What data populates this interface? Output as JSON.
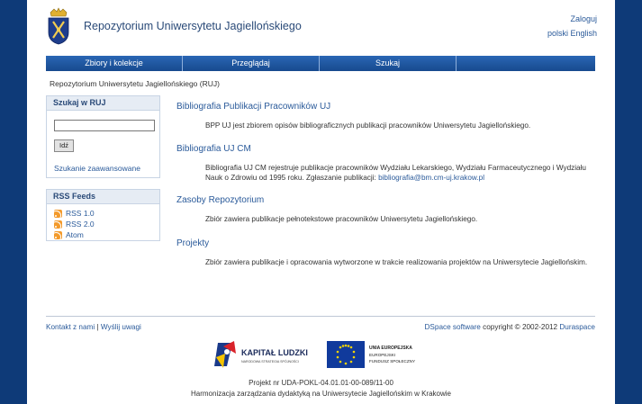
{
  "header": {
    "site_title": "Repozytorium Uniwersytetu Jagiellońskiego",
    "login": "Zaloguj",
    "lang_pl": "polski",
    "lang_en": "English"
  },
  "nav": [
    "Zbiory i kolekcje",
    "Przeglądaj",
    "Szukaj",
    ""
  ],
  "breadcrumb": "Repozytorium Uniwersytetu Jagiellońskiego (RUJ)",
  "search": {
    "title": "Szukaj w RUJ",
    "placeholder": "",
    "button": "Idź",
    "advanced": "Szukanie zaawansowane"
  },
  "rss": {
    "title": "RSS Feeds",
    "items": [
      "RSS 1.0",
      "RSS 2.0",
      "Atom"
    ]
  },
  "sections": [
    {
      "title": "Bibliografia Publikacji Pracowników UJ",
      "text": "BPP UJ jest zbiorem opisów bibliograficznych publikacji pracowników Uniwersytetu Jagiellońskiego."
    },
    {
      "title": "Bibliografia UJ CM",
      "text": "Bibliografia UJ CM rejestruje publikacje pracowników Wydziału Lekarskiego, Wydziału Farmaceutycznego i Wydziału Nauk o Zdrowiu od 1995 roku. Zgłaszanie publikacji: ",
      "link": "bibliografia@bm.cm-uj.krakow.pl"
    },
    {
      "title": "Zasoby Repozytorium",
      "text": "Zbiór zawiera publikacje pełnotekstowe pracowników Uniwersytetu Jagiellońskiego."
    },
    {
      "title": "Projekty",
      "text": "Zbiór zawiera publikacje i opracowania wytworzone w trakcie realizowania projektów na Uniwersytecie Jagiellońskim."
    }
  ],
  "footer": {
    "contact": "Kontakt z nami",
    "feedback": "Wyślij uwagi",
    "copyright_prefix": "DSpace software",
    "copyright": " copyright © 2002-2012 ",
    "dspace": "Duraspace",
    "kl_title": "KAPITAŁ LUDZKI",
    "kl_sub": "NARODOWA STRATEGIA SPÓJNOŚCI",
    "eu_line1": "UNIA EUROPEJSKA",
    "eu_line2": "EUROPEJSKI",
    "eu_line3": "FUNDUSZ SPOŁECZNY",
    "project": "Projekt nr UDA-POKL-04.01.01-00-089/11-00",
    "harmonization": "Harmonizacja zarządzania dydaktyką na Uniwersytecie Jagiellońskim w Krakowie"
  },
  "colors": {
    "nav": "#1f5aa6",
    "link": "#2a5a9a",
    "frame": "#0e3a78"
  }
}
